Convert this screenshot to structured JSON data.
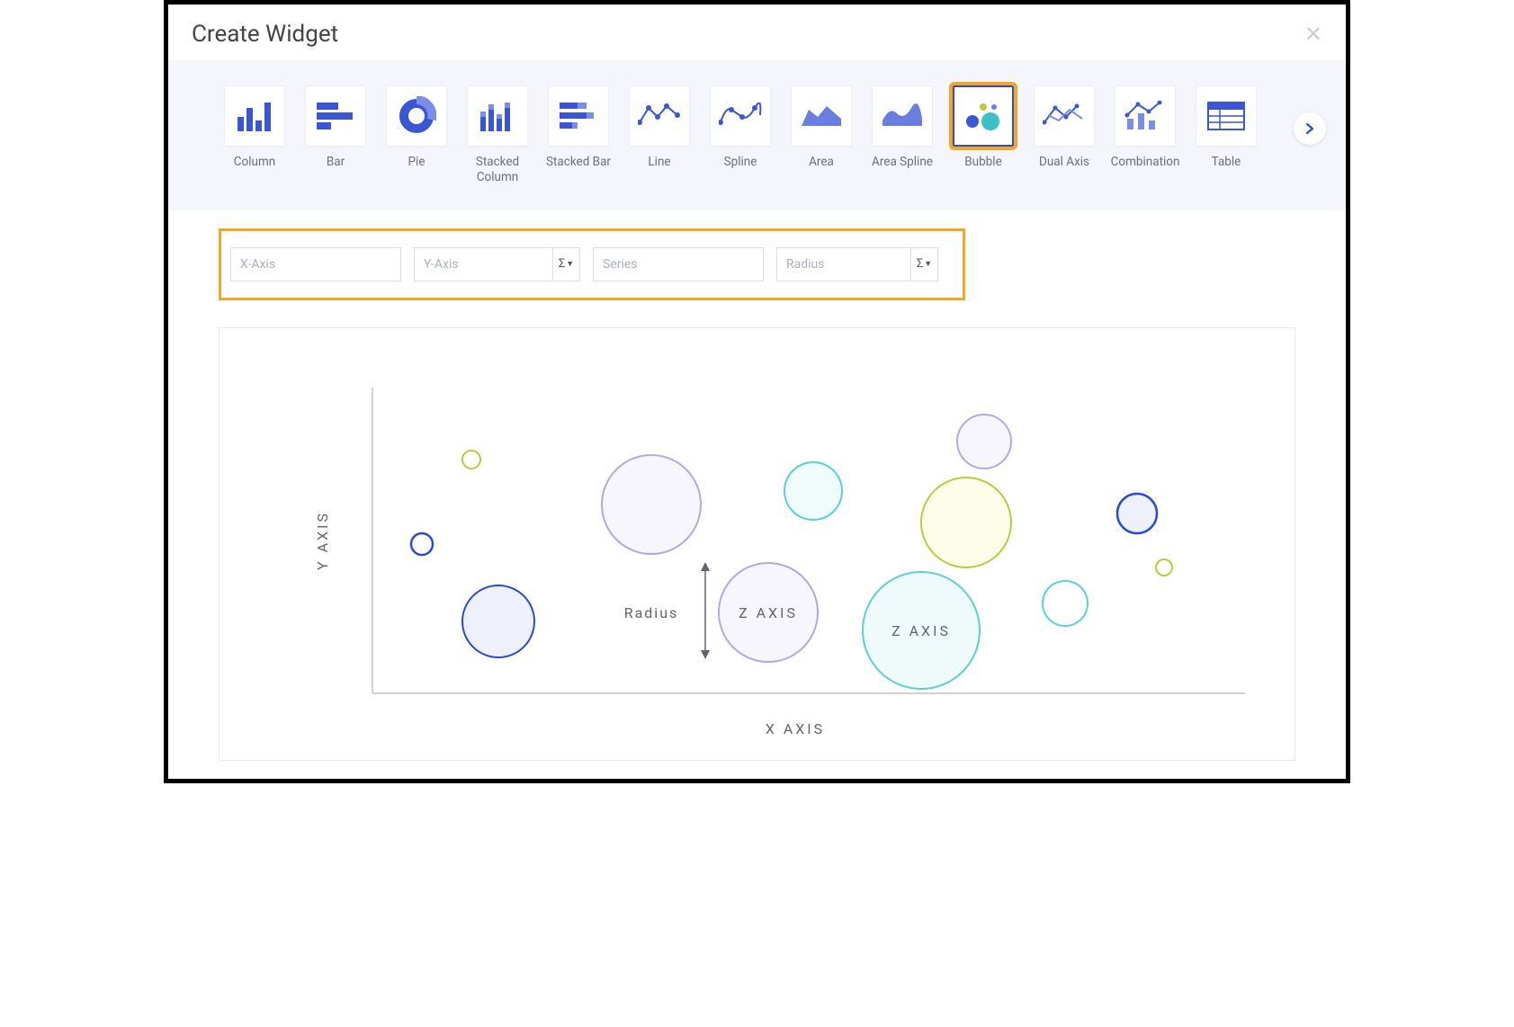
{
  "header": {
    "title": "Create Widget"
  },
  "chart_types": [
    {
      "key": "column",
      "label": "Column",
      "selected": false
    },
    {
      "key": "bar",
      "label": "Bar",
      "selected": false
    },
    {
      "key": "pie",
      "label": "Pie",
      "selected": false
    },
    {
      "key": "stacked-column",
      "label": "Stacked Column",
      "selected": false
    },
    {
      "key": "stacked-bar",
      "label": "Stacked Bar",
      "selected": false
    },
    {
      "key": "line",
      "label": "Line",
      "selected": false
    },
    {
      "key": "spline",
      "label": "Spline",
      "selected": false
    },
    {
      "key": "area",
      "label": "Area",
      "selected": false
    },
    {
      "key": "area-spline",
      "label": "Area Spline",
      "selected": false
    },
    {
      "key": "bubble",
      "label": "Bubble",
      "selected": true
    },
    {
      "key": "dual-axis",
      "label": "Dual Axis",
      "selected": false
    },
    {
      "key": "combination",
      "label": "Combination",
      "selected": false
    },
    {
      "key": "table",
      "label": "Table",
      "selected": false
    }
  ],
  "config": {
    "x_axis": {
      "placeholder": "X-Axis",
      "value": ""
    },
    "y_axis": {
      "placeholder": "Y-Axis",
      "value": "",
      "agg_symbol": "Σ"
    },
    "series": {
      "placeholder": "Series",
      "value": ""
    },
    "radius": {
      "placeholder": "Radius",
      "value": "",
      "agg_symbol": "Σ"
    }
  },
  "preview": {
    "x_axis_label": "X AXIS",
    "y_axis_label": "Y AXIS",
    "z_axis_label": "Z AXIS",
    "radius_label": "Radius"
  }
}
